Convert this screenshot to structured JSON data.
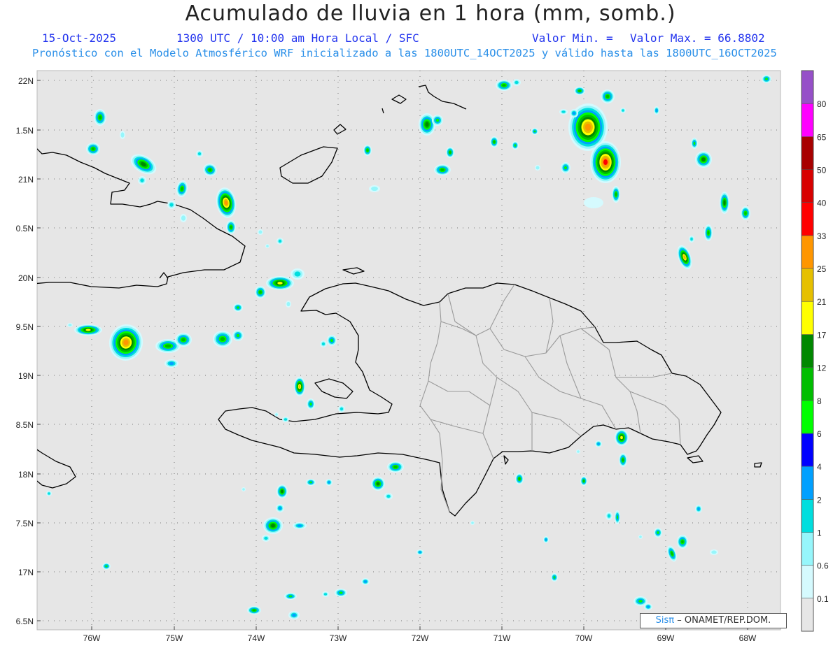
{
  "header": {
    "title": "Acumulado de lluvia en 1 hora (mm, somb.)",
    "date": "15-Oct-2025",
    "time": "1300 UTC / 10:00 am Hora Local / SFC",
    "min_label": "Valor Min. =",
    "max_label": "Valor Max. = 66.8802",
    "info": "Pronóstico con el Modelo Atmosférico WRF inicializado a las 1800UTC_14OCT2025 y válido hasta las  1800UTC_16OCT2025"
  },
  "lat_labels": [
    "22N",
    "1.5N",
    "21N",
    "0.5N",
    "20N",
    "9.5N",
    "19N",
    "8.5N",
    "18N",
    "7.5N",
    "17N",
    "6.5N"
  ],
  "lon_labels": [
    "76W",
    "75W",
    "74W",
    "73W",
    "72W",
    "71W",
    "70W",
    "69W",
    "68W"
  ],
  "colorbar": {
    "labels": [
      "0.1",
      "0.6",
      "1",
      "2",
      "4",
      "6",
      "8",
      "12",
      "17",
      "21",
      "25",
      "33",
      "40",
      "50",
      "65",
      "80"
    ],
    "colors": [
      "#e6e6e6",
      "#d5fafe",
      "#96f6fb",
      "#00dede",
      "#00a0ff",
      "#0000ff",
      "#00ff00",
      "#00be00",
      "#008800",
      "#ffff00",
      "#e6c000",
      "#ff9600",
      "#ff0000",
      "#d80000",
      "#a80000",
      "#ff00ff",
      "#9650c8"
    ]
  },
  "credit": {
    "prefix": "Sisπ",
    "suffix": "– ONAMET/REP.DOM."
  },
  "colors": {
    "title_blue": "#2233ee",
    "info_blue": "#2a8fe8",
    "map_bg": "#e6e6e6",
    "coast": "#000000",
    "province_border": "#999999"
  }
}
